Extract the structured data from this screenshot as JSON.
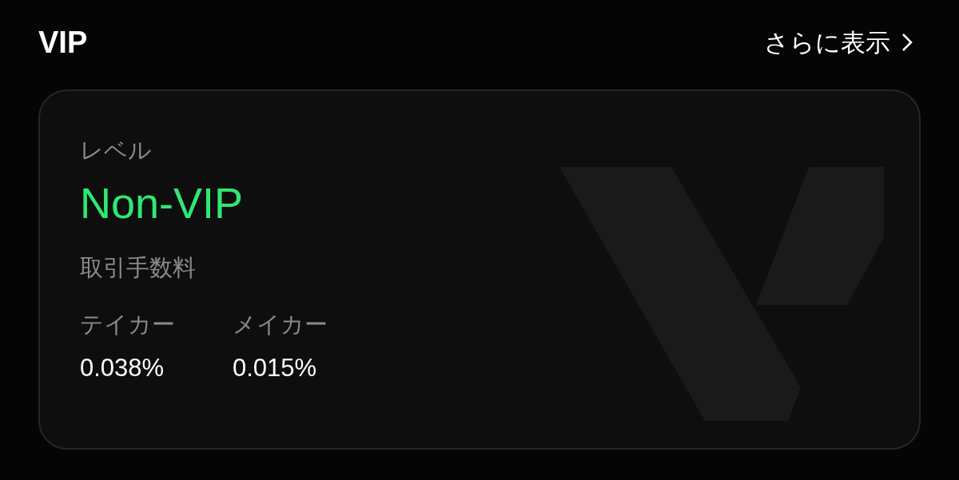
{
  "section": {
    "title": "VIP",
    "more_link": "さらに表示"
  },
  "card": {
    "level_label": "レベル",
    "level_value": "Non-VIP",
    "fees_label": "取引手数料",
    "fees": [
      {
        "label": "テイカー",
        "value": "0.038%"
      },
      {
        "label": "メイカー",
        "value": "0.015%"
      }
    ]
  }
}
